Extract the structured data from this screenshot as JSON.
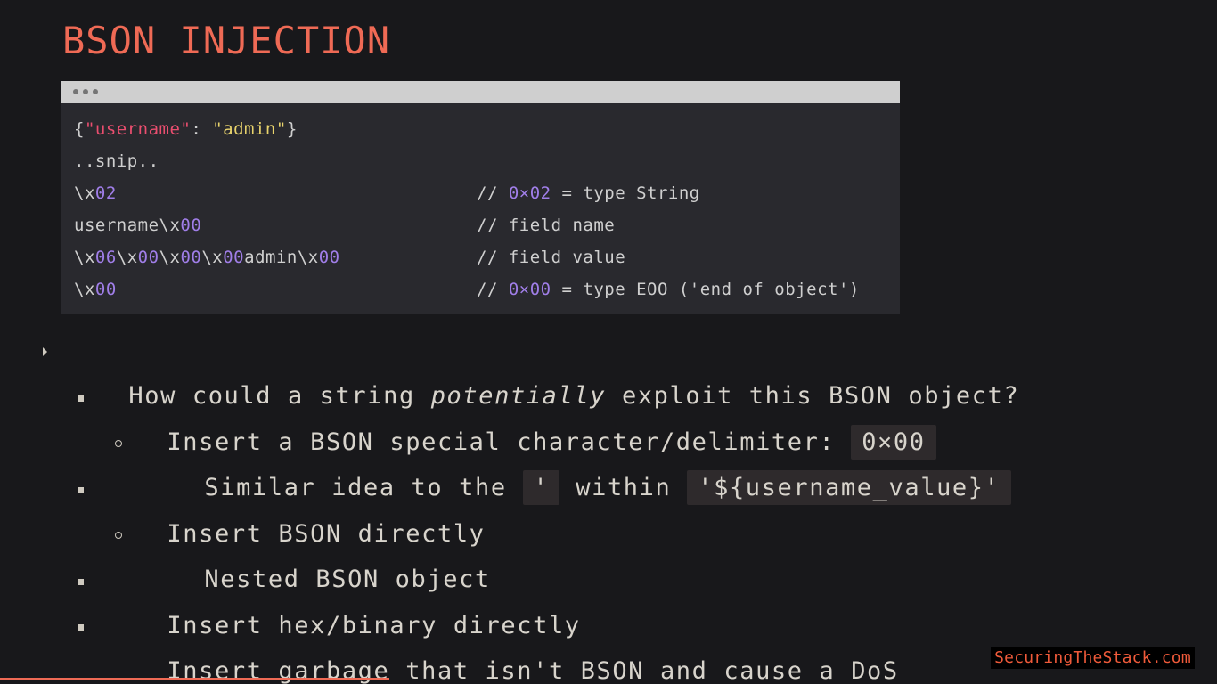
{
  "slide": {
    "title": "BSON INJECTION"
  },
  "code_window": {
    "lines": [
      {
        "segments": [
          {
            "text": "{",
            "role": "punct"
          },
          {
            "text": "\"username\"",
            "role": "key"
          },
          {
            "text": ": ",
            "role": "punct"
          },
          {
            "text": "\"admin\"",
            "role": "string"
          },
          {
            "text": "}",
            "role": "punct"
          }
        ],
        "comment": []
      },
      {
        "segments": [
          {
            "text": "..snip..",
            "role": "plain"
          }
        ],
        "comment": []
      },
      {
        "segments": [
          {
            "text": "\\x",
            "role": "plain"
          },
          {
            "text": "02",
            "role": "number"
          }
        ],
        "comment": [
          {
            "text": "// ",
            "role": "plain"
          },
          {
            "text": "0×02",
            "role": "number"
          },
          {
            "text": " = type String",
            "role": "plain"
          }
        ]
      },
      {
        "segments": [
          {
            "text": "username\\x",
            "role": "plain"
          },
          {
            "text": "00",
            "role": "number"
          }
        ],
        "comment": [
          {
            "text": "// field name",
            "role": "plain"
          }
        ]
      },
      {
        "segments": [
          {
            "text": "\\x",
            "role": "plain"
          },
          {
            "text": "06",
            "role": "number"
          },
          {
            "text": "\\x",
            "role": "plain"
          },
          {
            "text": "00",
            "role": "number"
          },
          {
            "text": "\\x",
            "role": "plain"
          },
          {
            "text": "00",
            "role": "number"
          },
          {
            "text": "\\x",
            "role": "plain"
          },
          {
            "text": "00",
            "role": "number"
          },
          {
            "text": "admin\\x",
            "role": "plain"
          },
          {
            "text": "00",
            "role": "number"
          }
        ],
        "comment": [
          {
            "text": "// field value",
            "role": "plain"
          }
        ]
      },
      {
        "segments": [
          {
            "text": "\\x",
            "role": "plain"
          },
          {
            "text": "00",
            "role": "number"
          }
        ],
        "comment": [
          {
            "text": "// ",
            "role": "plain"
          },
          {
            "text": "0×00",
            "role": "number"
          },
          {
            "text": " = type EOO ('end of object')",
            "role": "plain"
          }
        ]
      }
    ]
  },
  "bullets": {
    "b1": {
      "pre": "How could a string ",
      "em": "potentially",
      "post": " exploit this BSON object?"
    },
    "b2": {
      "text": "Insert a BSON special character/delimiter: ",
      "code": "0×00"
    },
    "b3": {
      "pre": "Similar idea to the ",
      "code1": "'",
      "mid": " within ",
      "code2": "'${username_value}'"
    },
    "b4": {
      "text": "Insert BSON directly"
    },
    "b5": {
      "text": "Nested BSON object"
    },
    "b6": {
      "text": "Insert hex/binary directly"
    },
    "b7": {
      "text": "Insert garbage that isn't BSON and cause a DoS"
    }
  },
  "branding": {
    "label": "SecuringTheStack.com"
  },
  "progress": {
    "fraction": 0.32
  },
  "colors": {
    "accent": "#ef6a55",
    "background": "#18181b",
    "code_bg": "#29292e",
    "key": "#ea4e6f",
    "string": "#e8d36c",
    "number": "#a07ee8",
    "brand": "#ef5a3a"
  }
}
